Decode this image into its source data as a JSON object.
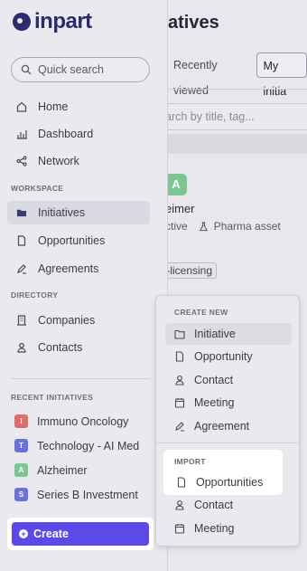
{
  "app": {
    "logo": "inpart"
  },
  "main": {
    "title": "atives",
    "tabs": [
      {
        "label": "Recently viewed"
      },
      {
        "label": "My initia"
      }
    ],
    "search_placeholder": "arch by title, tag...",
    "card": {
      "avatar_letter": "A",
      "title": "eimer",
      "status": "ctive",
      "type": "Pharma asset",
      "tag": "t-licensing"
    }
  },
  "sidebar": {
    "quick_search": "Quick search",
    "nav": [
      {
        "label": "Home"
      },
      {
        "label": "Dashboard"
      },
      {
        "label": "Network"
      }
    ],
    "workspace_label": "WORKSPACE",
    "workspace": [
      {
        "label": "Initiatives"
      },
      {
        "label": "Opportunities"
      },
      {
        "label": "Agreements"
      }
    ],
    "directory_label": "DIRECTORY",
    "directory": [
      {
        "label": "Companies"
      },
      {
        "label": "Contacts"
      }
    ],
    "recent_label": "RECENT INITIATIVES",
    "recent": [
      {
        "letter": "I",
        "label": "Immuno Oncology",
        "color": "#d9706f"
      },
      {
        "letter": "T",
        "label": "Technology - AI Med",
        "color": "#6a72d6"
      },
      {
        "letter": "A",
        "label": "Alzheimer",
        "color": "#7dc591"
      },
      {
        "letter": "S",
        "label": "Series B Investment",
        "color": "#6a72d6"
      }
    ],
    "create_label": "Create"
  },
  "menu": {
    "create_new_label": "CREATE NEW",
    "create_new": [
      {
        "label": "Initiative"
      },
      {
        "label": "Opportunity"
      },
      {
        "label": "Contact"
      },
      {
        "label": "Meeting"
      },
      {
        "label": "Agreement"
      }
    ],
    "import_label": "IMPORT",
    "import": [
      {
        "label": "Opportunities"
      },
      {
        "label": "Contact"
      },
      {
        "label": "Meeting"
      }
    ]
  },
  "colors": {
    "brand": "#2e2a6e",
    "accent": "#5b4ae8"
  }
}
